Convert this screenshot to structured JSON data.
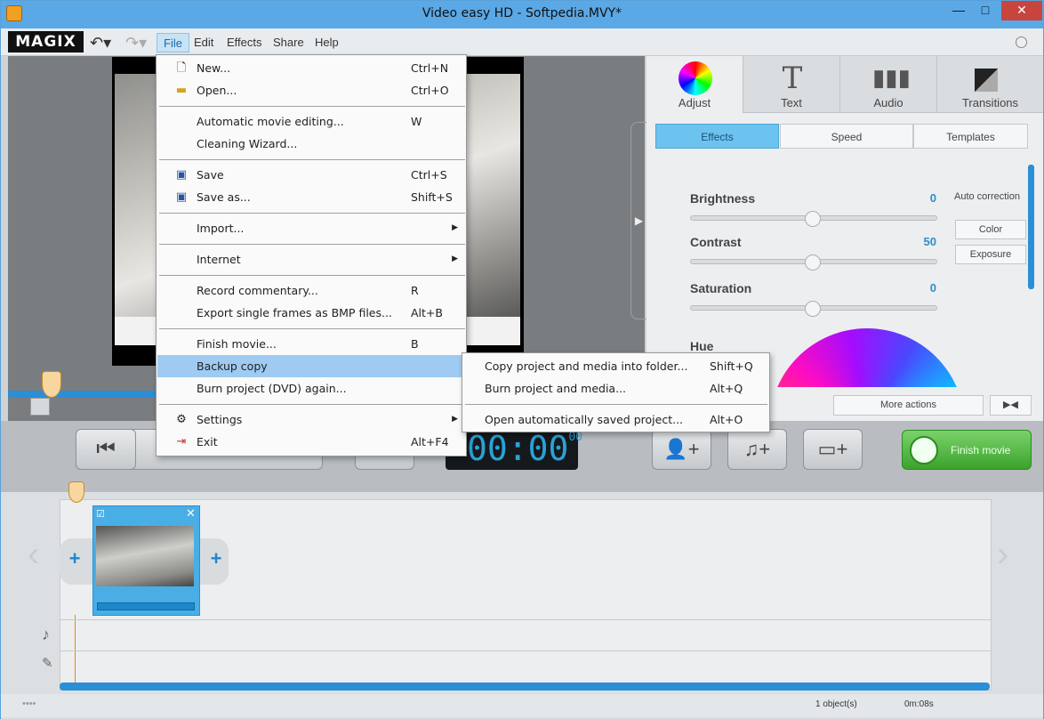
{
  "window": {
    "title": "Video easy HD - Softpedia.MVY*",
    "minimize": "—",
    "maximize": "□",
    "close": "✕"
  },
  "menubar": {
    "logo": "MAGIX",
    "items": [
      "File",
      "Edit",
      "Effects",
      "Share",
      "Help"
    ]
  },
  "file_menu": {
    "items": [
      {
        "label": "New...",
        "shortcut": "Ctrl+N",
        "icon": "new-doc-icon"
      },
      {
        "label": "Open...",
        "shortcut": "Ctrl+O",
        "icon": "folder-icon"
      },
      {
        "label": "Automatic movie editing...",
        "shortcut": "W"
      },
      {
        "label": "Cleaning Wizard...",
        "shortcut": ""
      },
      {
        "label": "Save",
        "shortcut": "Ctrl+S",
        "icon": "save-icon"
      },
      {
        "label": "Save as...",
        "shortcut": "Shift+S",
        "icon": "save-as-icon"
      },
      {
        "label": "Import...",
        "shortcut": "",
        "submenu": true
      },
      {
        "label": "Internet",
        "shortcut": "",
        "submenu": true
      },
      {
        "label": "Record commentary...",
        "shortcut": "R"
      },
      {
        "label": "Export single frames as BMP files...",
        "shortcut": "Alt+B"
      },
      {
        "label": "Finish movie...",
        "shortcut": "B"
      },
      {
        "label": "Backup copy",
        "shortcut": "",
        "submenu": true,
        "highlighted": true
      },
      {
        "label": "Burn project (DVD) again...",
        "shortcut": ""
      },
      {
        "label": "Settings",
        "shortcut": "",
        "submenu": true,
        "icon": "gear-icon"
      },
      {
        "label": "Exit",
        "shortcut": "Alt+F4",
        "icon": "exit-icon"
      }
    ]
  },
  "backup_submenu": {
    "items": [
      {
        "label": "Copy project and media into folder...",
        "shortcut": "Shift+Q"
      },
      {
        "label": "Burn project and media...",
        "shortcut": "Alt+Q"
      },
      {
        "label": "Open automatically saved project...",
        "shortcut": "Alt+O"
      }
    ]
  },
  "panel": {
    "tabs": [
      "Adjust",
      "Text",
      "Audio",
      "Transitions"
    ],
    "subtabs": [
      "Effects",
      "Speed",
      "Templates"
    ],
    "sliders": [
      {
        "label": "Brightness",
        "value": "0"
      },
      {
        "label": "Contrast",
        "value": "50"
      },
      {
        "label": "Saturation",
        "value": "0"
      }
    ],
    "hue_label": "Hue",
    "auto_correction": "Auto correction",
    "color_button": "Color",
    "exposure_button": "Exposure",
    "more_actions": "More actions"
  },
  "transport": {
    "timer": "00:00",
    "timer_frames": "00",
    "finish_movie": "Finish movie"
  },
  "status": {
    "objects": "1 object(s)",
    "duration": "0m:08s"
  },
  "colors": {
    "accent": "#2a8fd6",
    "highlight": "#9fcbf2",
    "finish": "#3ba32d"
  }
}
